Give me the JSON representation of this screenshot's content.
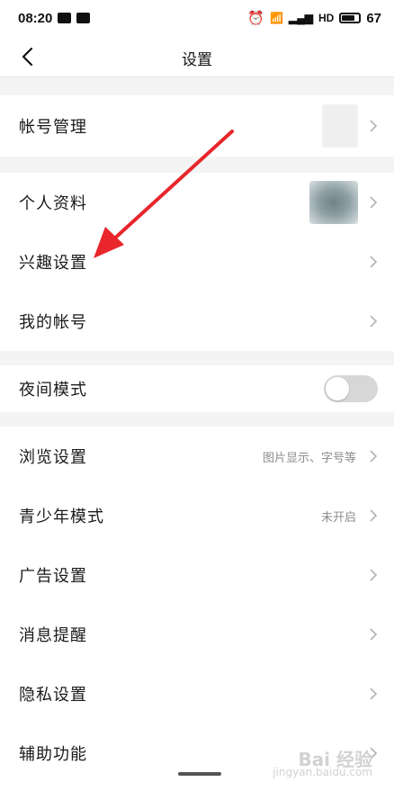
{
  "status_bar": {
    "time": "08:20",
    "battery": "67",
    "icons": [
      "notification-icon",
      "image-icon",
      "alarm-icon",
      "wifi-icon",
      "signal-icon",
      "hd-icon",
      "battery-icon"
    ]
  },
  "nav": {
    "title": "设置",
    "back_icon": "chevron-left-icon"
  },
  "groups": {
    "account": {
      "items": [
        {
          "label": "帐号管理"
        }
      ]
    },
    "profile": {
      "items": [
        {
          "label": "个人资料"
        },
        {
          "label": "兴趣设置"
        },
        {
          "label": "我的帐号"
        }
      ]
    },
    "display": {
      "items": [
        {
          "label": "夜间模式",
          "toggle": false
        }
      ]
    },
    "settings": {
      "items": [
        {
          "label": "浏览设置",
          "detail": "图片显示、字号等"
        },
        {
          "label": "青少年模式",
          "detail": "未开启"
        },
        {
          "label": "广告设置"
        },
        {
          "label": "消息提醒"
        },
        {
          "label": "隐私设置"
        },
        {
          "label": "辅助功能"
        }
      ]
    }
  },
  "annotation": {
    "color": "#e8262b"
  },
  "watermark": {
    "line1": "Bai 经验",
    "line2": "jingyan.baidu.com"
  },
  "colors": {
    "background": "#f4f4f4",
    "card": "#ffffff",
    "toggle_off": "#d7d7d7"
  }
}
